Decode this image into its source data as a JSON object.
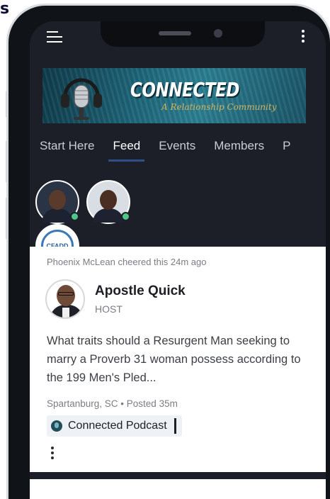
{
  "page_glyph": "s",
  "header": {
    "menu_icon": "hamburger-menu-icon",
    "more_icon": "more-vertical-icon"
  },
  "banner": {
    "title": "CONNECTED",
    "subtitle": "A Relationship Community"
  },
  "tabs": [
    {
      "label": "Start Here",
      "active": false
    },
    {
      "label": "Feed",
      "active": true
    },
    {
      "label": "Events",
      "active": false
    },
    {
      "label": "Members",
      "active": false
    },
    {
      "label": "P",
      "active": false
    }
  ],
  "members": [
    {
      "type": "person",
      "online": true
    },
    {
      "type": "person",
      "online": true
    },
    {
      "type": "logo",
      "logo_text": "CFADD",
      "online": true
    },
    {
      "type": "person",
      "online": true
    },
    {
      "type": "person",
      "online": false
    },
    {
      "type": "person",
      "online": false
    }
  ],
  "post": {
    "activity": "Phoenix McLean cheered this 24m ago",
    "author": "Apostle Quick",
    "role": "HOST",
    "text": "What traits should a Resurgent Man seeking to marry a Proverb 31 woman possess according to the 199 Men's Pled...",
    "meta": "Spartanburg, SC • Posted 35m",
    "space": "Connected Podcast"
  },
  "colors": {
    "app_background": "#1c1f27",
    "accent_tab_underline": "#2f4f88",
    "online_status": "#4fc58a",
    "banner_teal": "#1d6478"
  }
}
